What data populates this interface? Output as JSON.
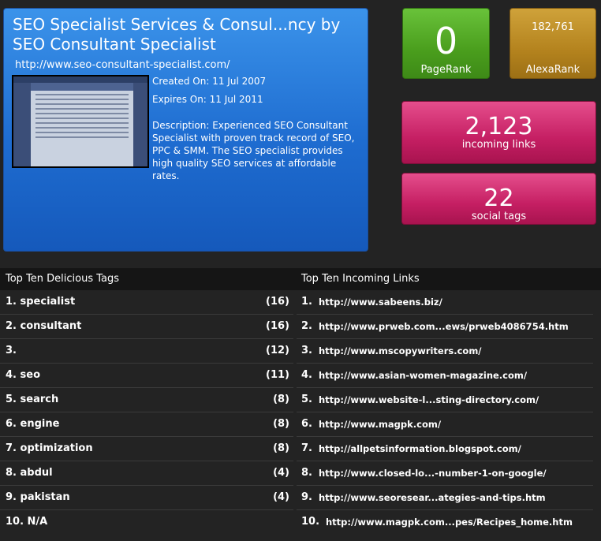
{
  "site": {
    "title": "SEO Specialist Services & Consul...ncy by SEO Consultant Specialist",
    "url": "http://www.seo-consultant-specialist.com/",
    "created": "Created On: 11 Jul 2007",
    "expires": "Expires On: 11 Jul 2011",
    "description": "Description: Experienced SEO Consultant Specialist with proven track record of SEO, PPC & SMM. The SEO specialist provides high quality SEO services at affordable rates."
  },
  "stats": {
    "pagerank": {
      "value": "0",
      "label": "PageRank"
    },
    "alexa": {
      "value": "182,761",
      "label": "AlexaRank"
    },
    "links": {
      "value": "2,123",
      "label": "incoming links"
    },
    "tags": {
      "value": "22",
      "label": "social tags"
    }
  },
  "tags_panel": {
    "title": "Top Ten Delicious Tags",
    "items": [
      {
        "name": "1. specialist",
        "count": "(16)"
      },
      {
        "name": "2. consultant",
        "count": "(16)"
      },
      {
        "name": "3.",
        "count": "(12)"
      },
      {
        "name": "4. seo",
        "count": "(11)"
      },
      {
        "name": "5. search",
        "count": "(8)"
      },
      {
        "name": "6. engine",
        "count": "(8)"
      },
      {
        "name": "7. optimization",
        "count": "(8)"
      },
      {
        "name": "8. abdul",
        "count": "(4)"
      },
      {
        "name": "9. pakistan",
        "count": "(4)"
      },
      {
        "name": "10. N/A",
        "count": ""
      }
    ]
  },
  "links_panel": {
    "title": "Top Ten Incoming Links",
    "items": [
      {
        "num": "1.",
        "url": "http://www.sabeens.biz/"
      },
      {
        "num": "2.",
        "url": "http://www.prweb.com...ews/prweb4086754.htm"
      },
      {
        "num": "3.",
        "url": "http://www.mscopywriters.com/"
      },
      {
        "num": "4.",
        "url": "http://www.asian-women-magazine.com/"
      },
      {
        "num": "5.",
        "url": "http://www.website-l...sting-directory.com/"
      },
      {
        "num": "6.",
        "url": "http://www.magpk.com/"
      },
      {
        "num": "7.",
        "url": "http://allpetsinformation.blogspot.com/"
      },
      {
        "num": "8.",
        "url": "http://www.closed-lo...-number-1-on-google/"
      },
      {
        "num": "9.",
        "url": "http://www.seoresear...ategies-and-tips.htm"
      },
      {
        "num": "10.",
        "url": "http://www.magpk.com...pes/Recipes_home.htm"
      }
    ]
  }
}
